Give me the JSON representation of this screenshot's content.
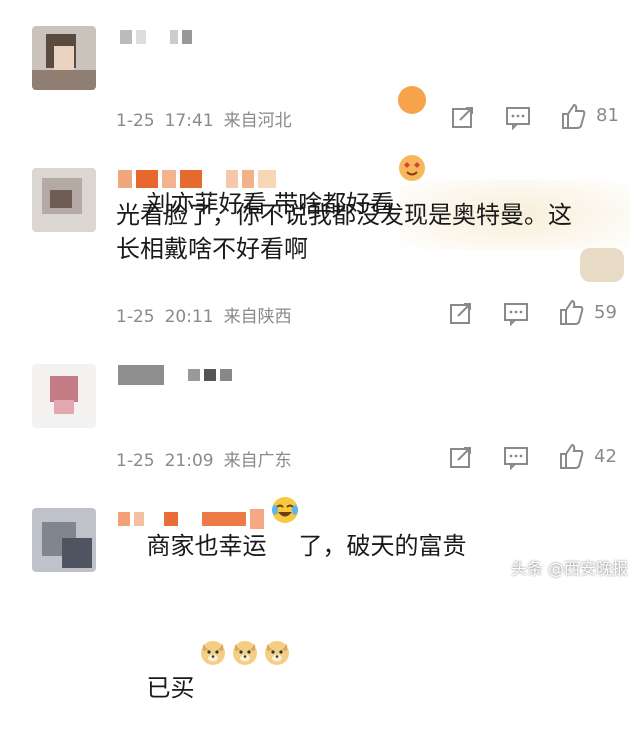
{
  "comments": [
    {
      "text": "刘亦菲好看 带啥都好看",
      "emoji": "heart-eyes-face",
      "date": "1-25",
      "time": "17:41",
      "location": "来自河北",
      "likes": "81"
    },
    {
      "text": "光看脸了，你不说我都没发现是奥特曼。这\n长相戴啥不好看啊",
      "date": "1-25",
      "time": "20:11",
      "location": "来自陕西",
      "likes": "59"
    },
    {
      "text": "商家也幸运",
      "emoji": "tears-of-joy-face",
      "text_after": "了，破天的富贵",
      "date": "1-25",
      "time": "21:09",
      "location": "来自广东",
      "likes": "42"
    },
    {
      "text": "已买",
      "emoji": "doge-face"
    }
  ],
  "watermark": "头条 @西安晚报",
  "colors": {
    "meta_gray": "#8a8a8a",
    "icon_gray": "#8a8a8a",
    "username_orange": "#f08a5b"
  }
}
